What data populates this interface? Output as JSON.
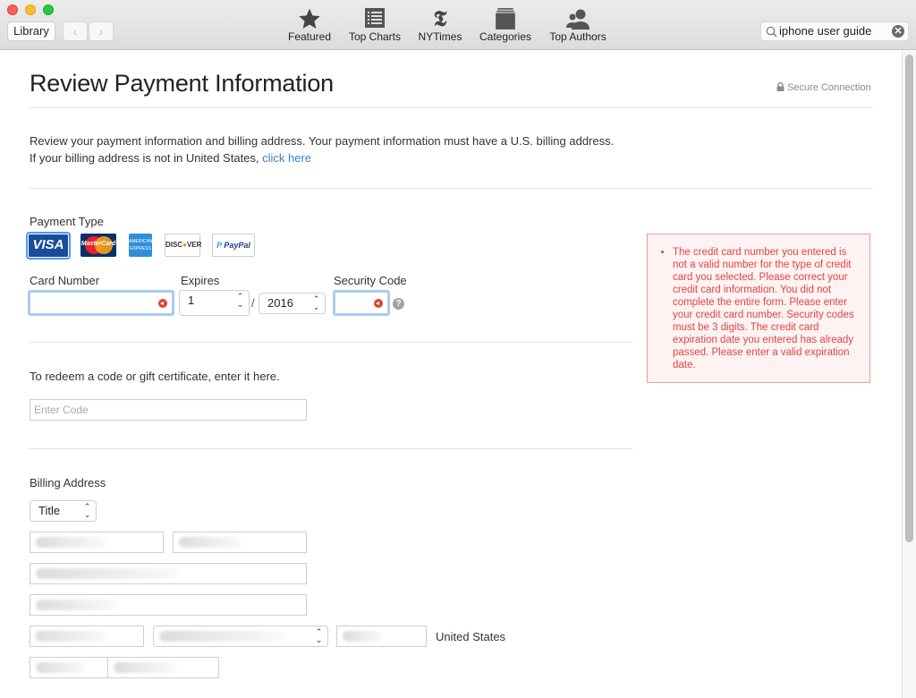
{
  "window": {
    "controls": [
      "close",
      "minimize",
      "zoom"
    ]
  },
  "toolbar": {
    "library_label": "Library",
    "back_icon": "chevron-left-icon",
    "forward_icon": "chevron-right-icon",
    "tabs": [
      {
        "label": "Featured",
        "icon": "star-icon"
      },
      {
        "label": "Top Charts",
        "icon": "list-icon"
      },
      {
        "label": "NYTimes",
        "icon": "nytimes-icon"
      },
      {
        "label": "Categories",
        "icon": "stack-icon"
      },
      {
        "label": "Top Authors",
        "icon": "people-icon"
      }
    ],
    "search": {
      "value": "iphone user guide",
      "icon": "search-icon",
      "clear_icon": "clear-icon"
    }
  },
  "page": {
    "title": "Review Payment Information",
    "secure_label": "Secure Connection",
    "intro_line1": "Review your payment information and billing address. Your payment information must have a U.S. billing address.",
    "intro_line2": "If your billing address is not in United States, ",
    "intro_link": "click here"
  },
  "payment": {
    "type_label": "Payment Type",
    "cards": [
      {
        "name": "VISA",
        "selected": true
      },
      {
        "name": "MasterCard",
        "selected": false
      },
      {
        "name": "American Express",
        "selected": false
      },
      {
        "name": "DISCOVER",
        "selected": false
      },
      {
        "name": "PayPal",
        "selected": false
      }
    ],
    "card_number_label": "Card Number",
    "card_number_value": "",
    "expires_label": "Expires",
    "expires_month": "1",
    "expires_separator": "/",
    "expires_year": "2016",
    "security_code_label": "Security Code",
    "security_code_value": "",
    "help_icon": "?"
  },
  "error": {
    "message": "The credit card number you entered is not a valid number for the type of credit card you selected. Please correct your credit card information. You did not complete the entire form. Please enter your credit card number. Security codes must be 3 digits. The credit card expiration date you entered has already passed. Please enter a valid expiration date."
  },
  "redeem": {
    "label": "To redeem a code or gift certificate, enter it here.",
    "placeholder": "Enter Code"
  },
  "billing": {
    "label": "Billing Address",
    "title_select": "Title",
    "country": "United States"
  }
}
